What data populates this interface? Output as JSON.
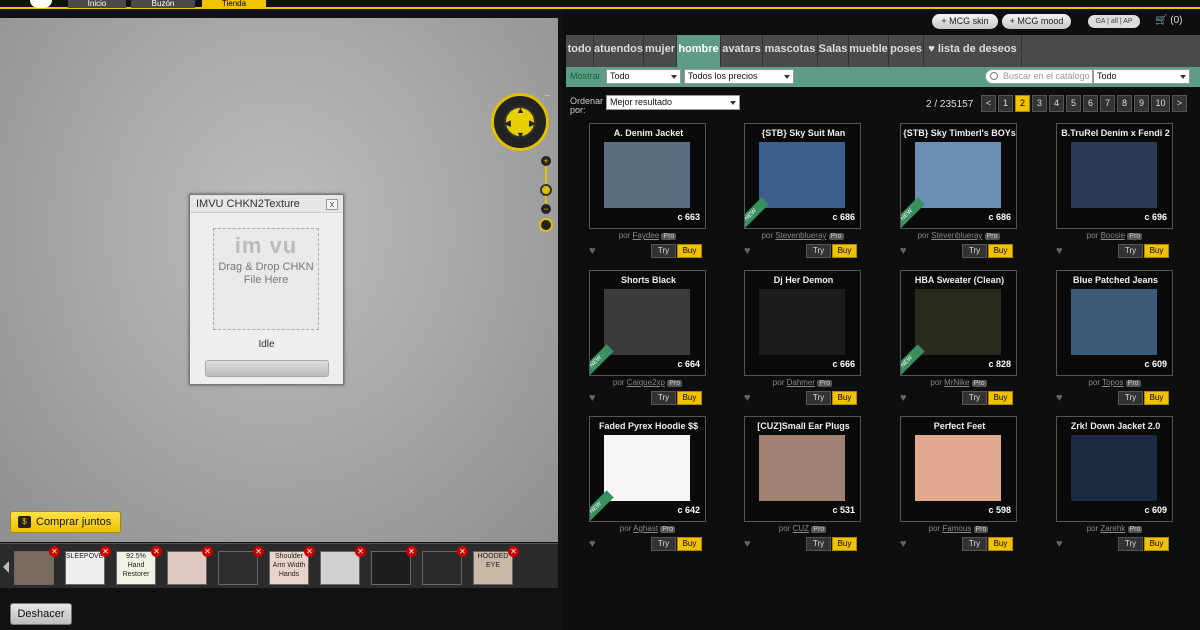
{
  "topnav": {
    "tabs": [
      "Inicio",
      "Buzón",
      "Tienda"
    ]
  },
  "viewport": {
    "chkn_window": {
      "title": "IMVU CHKN2Texture",
      "close": "x",
      "logo_text": "im vu",
      "drop_text": "Drag & Drop CHKN File Here",
      "status": "Idle"
    },
    "buy_together_label": "Comprar juntos",
    "undo_label": "Deshacer"
  },
  "strip_items": [
    {
      "label": ""
    },
    {
      "label": "SLEEPOVER"
    },
    {
      "label": "92.5% Hand Restorer"
    },
    {
      "label": ""
    },
    {
      "label": ""
    },
    {
      "label": "Shoulder Arm Width Hands"
    },
    {
      "label": ""
    },
    {
      "label": ""
    },
    {
      "label": ""
    },
    {
      "label": "HOODED EYE"
    }
  ],
  "header": {
    "mcg_skin": "+ MCG skin",
    "mcg_mood": "+ MCG mood",
    "langs": "GA | all | AP",
    "cart": "(0)"
  },
  "categories": [
    {
      "label": "todo"
    },
    {
      "label": "atuendos"
    },
    {
      "label": "mujer"
    },
    {
      "label": "hombre"
    },
    {
      "label": "avatars"
    },
    {
      "label": "mascotas"
    },
    {
      "label": "Salas"
    },
    {
      "label": "mueble"
    },
    {
      "label": "poses"
    },
    {
      "label": "♥  lista de deseos"
    }
  ],
  "filters": {
    "show_label": "Mostrar",
    "show_value": "Todo",
    "price_value": "Todos los precios",
    "search_placeholder": "Buscar en el catálogo",
    "search_scope": "Todo"
  },
  "sort": {
    "label_1": "Ordenar",
    "label_2": "por:",
    "value": "Mejor resultado",
    "page_count": "2 / 235157"
  },
  "pagination": [
    "<",
    "1",
    "2",
    "3",
    "4",
    "5",
    "6",
    "7",
    "8",
    "9",
    "10",
    ">"
  ],
  "products": [
    {
      "name": "A. Denim Jacket",
      "price": "c 663",
      "creator": "Faydee",
      "new": false,
      "img": "#5b6d80"
    },
    {
      "name": "{STB} Sky Suit Man",
      "price": "c 686",
      "creator": "Stevenblueray",
      "new": true,
      "img": "#3d5f8c"
    },
    {
      "name": "{STB} Sky Timberl's BOYs",
      "price": "c 686",
      "creator": "Stevenblueray",
      "new": true,
      "img": "#6c8fb4"
    },
    {
      "name": "B.TruRel Denim x Fendi 2",
      "price": "c 696",
      "creator": "Boosie",
      "new": false,
      "img": "#2b3a55"
    },
    {
      "name": "Shorts Black",
      "price": "c 664",
      "creator": "Caique2xp",
      "new": true,
      "img": "#3b3b3b"
    },
    {
      "name": "Dj Her Demon",
      "price": "c 666",
      "creator": "Dahmer",
      "new": false,
      "img": "#1c1c1c"
    },
    {
      "name": "HBA Sweater (Clean)",
      "price": "c 828",
      "creator": "MrNike",
      "new": true,
      "img": "#2a2a1c"
    },
    {
      "name": "Blue Patched Jeans",
      "price": "c 609",
      "creator": "Topos",
      "new": false,
      "img": "#3e5a78"
    },
    {
      "name": "Faded Pyrex Hoodie $$",
      "price": "c 642",
      "creator": "Aghast",
      "new": true,
      "img": "#f7f5f5"
    },
    {
      "name": "[CUZ]Small Ear Plugs",
      "price": "c 531",
      "creator": "CUZ",
      "new": false,
      "img": "#a08272"
    },
    {
      "name": "Perfect Feet",
      "price": "c 598",
      "creator": "Famous",
      "new": false,
      "img": "#e0a990"
    },
    {
      "name": "Zrk! Down Jacket 2.0",
      "price": "c 609",
      "creator": "Zarehk",
      "new": false,
      "img": "#1c2a44"
    }
  ],
  "card_labels": {
    "by": "por",
    "pro": "Pro",
    "try": "Try",
    "buy": "Buy"
  }
}
